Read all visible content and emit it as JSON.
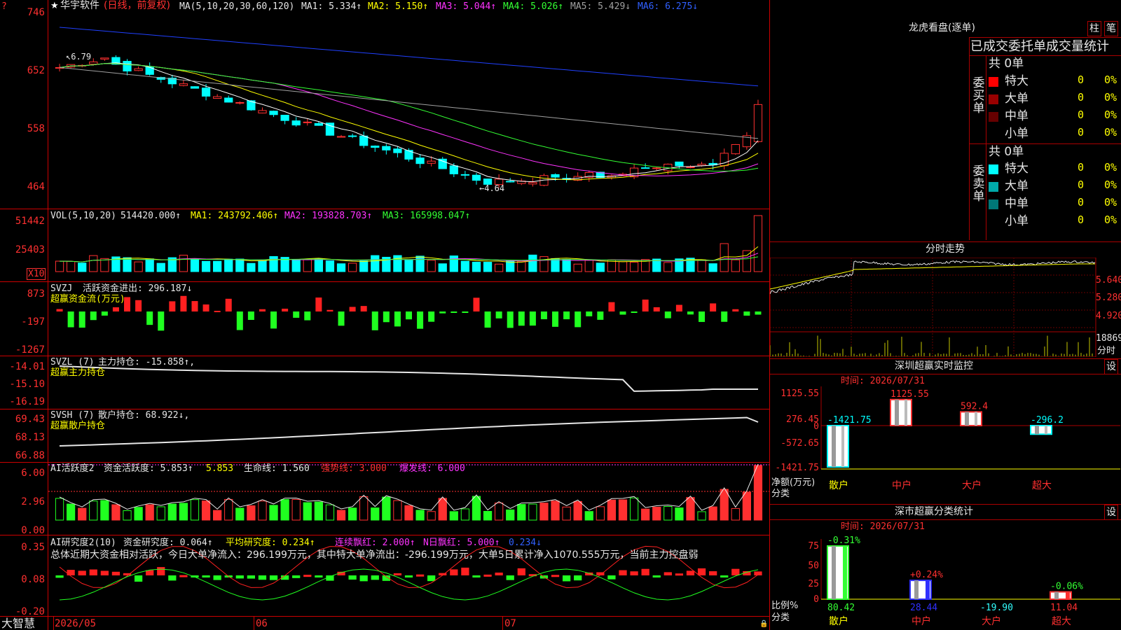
{
  "main": {
    "title_star": "★",
    "stock_name": "华宇软件",
    "period_mode": "(日线，前复权)",
    "ma_params": "MA(5,10,20,30,60,120)",
    "ma1": "MA1: 5.334↑",
    "ma2": "MA2: 5.150↑",
    "ma3": "MA3: 5.044↑",
    "ma4": "MA4: 5.026↑",
    "ma5": "MA5: 5.429↓",
    "ma6": "MA6: 6.275↓",
    "high_marker": "6.79",
    "low_marker": "4.64",
    "axis": [
      "746",
      "652",
      "558",
      "464"
    ],
    "top_marker": "?"
  },
  "vol": {
    "label": "VOL(5,10,20)",
    "value": "514420.000↑",
    "ma1": "MA1: 243792.406↑",
    "ma2": "MA2: 193828.703↑",
    "ma3": "MA3: 165998.047↑",
    "axis": [
      "51442",
      "25403"
    ],
    "unit": "X10"
  },
  "svzj": {
    "label": "SVZJ",
    "name": "活跃资金进出: 296.187↓",
    "subtitle": "超赢资金流(万元)",
    "axis": [
      "873",
      "-197",
      "-1267"
    ]
  },
  "svzl": {
    "label": "SVZL (7)",
    "name": "主力持仓: -15.858↑,",
    "subtitle": "超赢主力持仓",
    "axis": [
      "-14.01",
      "-15.10",
      "-16.19"
    ]
  },
  "svsh": {
    "label": "SVSH (7)",
    "name": "散户持仓: 68.922↓,",
    "subtitle": "超赢散户持仓",
    "axis": [
      "69.43",
      "68.13",
      "66.88"
    ]
  },
  "ai_active": {
    "label": "AI活跃度2",
    "p1": "资金活跃度: 5.853↑",
    "p2": "5.853",
    "p3": "生命线: 1.560",
    "p4": "强势线: 3.000",
    "p5": "爆发线: 6.000",
    "axis": [
      "6.00",
      "2.96",
      "0.00"
    ]
  },
  "ai_research": {
    "label": "AI研究度2(10)",
    "p1": "资金研究度: 0.064↑",
    "p2": "平均研究度: 0.234↑",
    "p3": "连续飘红: 2.000↑",
    "p4": "N日飘红: 5.000↑",
    "p5": "0.234↓",
    "summary": "总体近期大资金相对活跃，今日大单净流入：296.199万元，其中特大单净流出：-296.199万元，大单5日累计净入1070.555万元，当前主力控盘弱",
    "axis": [
      "0.35",
      "0.08",
      "-0.20"
    ]
  },
  "xaxis": {
    "brand": "大智慧",
    "labels": [
      "2026/05",
      "06",
      "07"
    ]
  },
  "right": {
    "lhb": {
      "title": "龙虎看盘(逐单)",
      "btn_zhu": "柱",
      "btn_bi": "笔",
      "tab_header": "已成交委托单成交量统计",
      "buy_label": "委买单",
      "sell_label": "委卖单",
      "buy_total": "共 0单",
      "sell_total": "共 0单",
      "buy_rows": [
        {
          "name": "特大",
          "qty": "0",
          "pct": "0%",
          "color": "#ff0000"
        },
        {
          "name": "大单",
          "qty": "0",
          "pct": "0%",
          "color": "#990000"
        },
        {
          "name": "中单",
          "qty": "0",
          "pct": "0%",
          "color": "#660000"
        },
        {
          "name": "小单",
          "qty": "0",
          "pct": "0%",
          "color": "#000000"
        }
      ],
      "sell_rows": [
        {
          "name": "特大",
          "qty": "0",
          "pct": "0%",
          "color": "#00ffff"
        },
        {
          "name": "大单",
          "qty": "0",
          "pct": "0%",
          "color": "#00aaaa"
        },
        {
          "name": "中单",
          "qty": "0",
          "pct": "0%",
          "color": "#007777"
        },
        {
          "name": "小单",
          "qty": "0",
          "pct": "0%",
          "color": "#000000"
        }
      ]
    },
    "minute": {
      "title": "分时走势",
      "axis": [
        "5.640",
        "5.280",
        "4.920"
      ],
      "vol_axis": "18869",
      "vol_label": "分时"
    },
    "sz_monitor": {
      "title": "深圳超赢实时监控",
      "set": "设",
      "time": "时间: 2026/07/31",
      "axis": [
        "1125.55",
        "276.45",
        "0",
        "-572.65",
        "-1421.75"
      ],
      "unit1": "净额(万元)",
      "unit2": "分类",
      "bars": [
        {
          "cat": "散户",
          "val": "-1421.75"
        },
        {
          "cat": "中户",
          "val": "1125.55"
        },
        {
          "cat": "大户",
          "val": "592.4"
        },
        {
          "cat": "超大",
          "val": "-296.2"
        }
      ]
    },
    "sz_stats": {
      "title": "深市超赢分类统计",
      "set": "设",
      "time": "时间: 2026/07/31",
      "axis": [
        "75",
        "50",
        "25",
        "0"
      ],
      "unit1": "比例%",
      "unit2": "分类",
      "bars": [
        {
          "cat": "散户",
          "pct": "-0.31%",
          "val": "80.42"
        },
        {
          "cat": "中户",
          "pct": "+0.24%",
          "val": "28.44"
        },
        {
          "cat": "大户",
          "pct": "",
          "val": "-19.90"
        },
        {
          "cat": "超大",
          "pct": "-0.06%",
          "val": "11.04"
        }
      ]
    }
  }
}
